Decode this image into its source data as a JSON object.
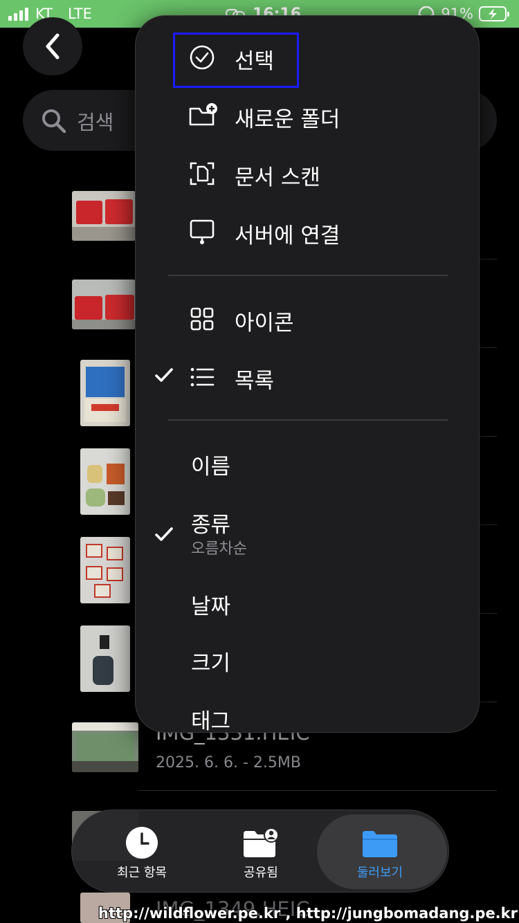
{
  "status_bar": {
    "carrier": "KT",
    "network": "LTE",
    "time": "16:16",
    "battery": "91%",
    "colors": {
      "background": "#6ac46a"
    }
  },
  "search": {
    "placeholder": "검색"
  },
  "files": [
    {
      "name": "IMG_1331.HEIC",
      "meta": "2025. 6. 6. - 2.5MB"
    },
    {
      "name": "IMG_1349.HEIC"
    }
  ],
  "menu": {
    "actions": [
      {
        "label": "선택",
        "icon": "checkmark-circle-icon"
      },
      {
        "label": "새로운 폴더",
        "icon": "folder-plus-icon"
      },
      {
        "label": "문서 스캔",
        "icon": "document-scan-icon"
      },
      {
        "label": "서버에 연결",
        "icon": "server-connect-icon"
      }
    ],
    "views": [
      {
        "label": "아이콘",
        "icon": "grid-icon",
        "checked": false
      },
      {
        "label": "목록",
        "icon": "list-icon",
        "checked": true
      }
    ],
    "sort": [
      {
        "label": "이름",
        "checked": false
      },
      {
        "label": "종류",
        "checked": true,
        "detail": "오름차순"
      },
      {
        "label": "날짜",
        "checked": false
      },
      {
        "label": "크기",
        "checked": false
      },
      {
        "label": "태그",
        "checked": false
      }
    ]
  },
  "tab_bar": {
    "tabs": [
      {
        "label": "최근 항목",
        "icon": "clock-icon"
      },
      {
        "label": "공유됨",
        "icon": "shared-folder-icon"
      },
      {
        "label": "둘러보기",
        "icon": "folder-icon",
        "active": true
      }
    ],
    "colors": {
      "active": "#3d9bf5"
    }
  },
  "watermark": "http://wildflower.pe.kr , http://jungbomadang.pe.kr"
}
